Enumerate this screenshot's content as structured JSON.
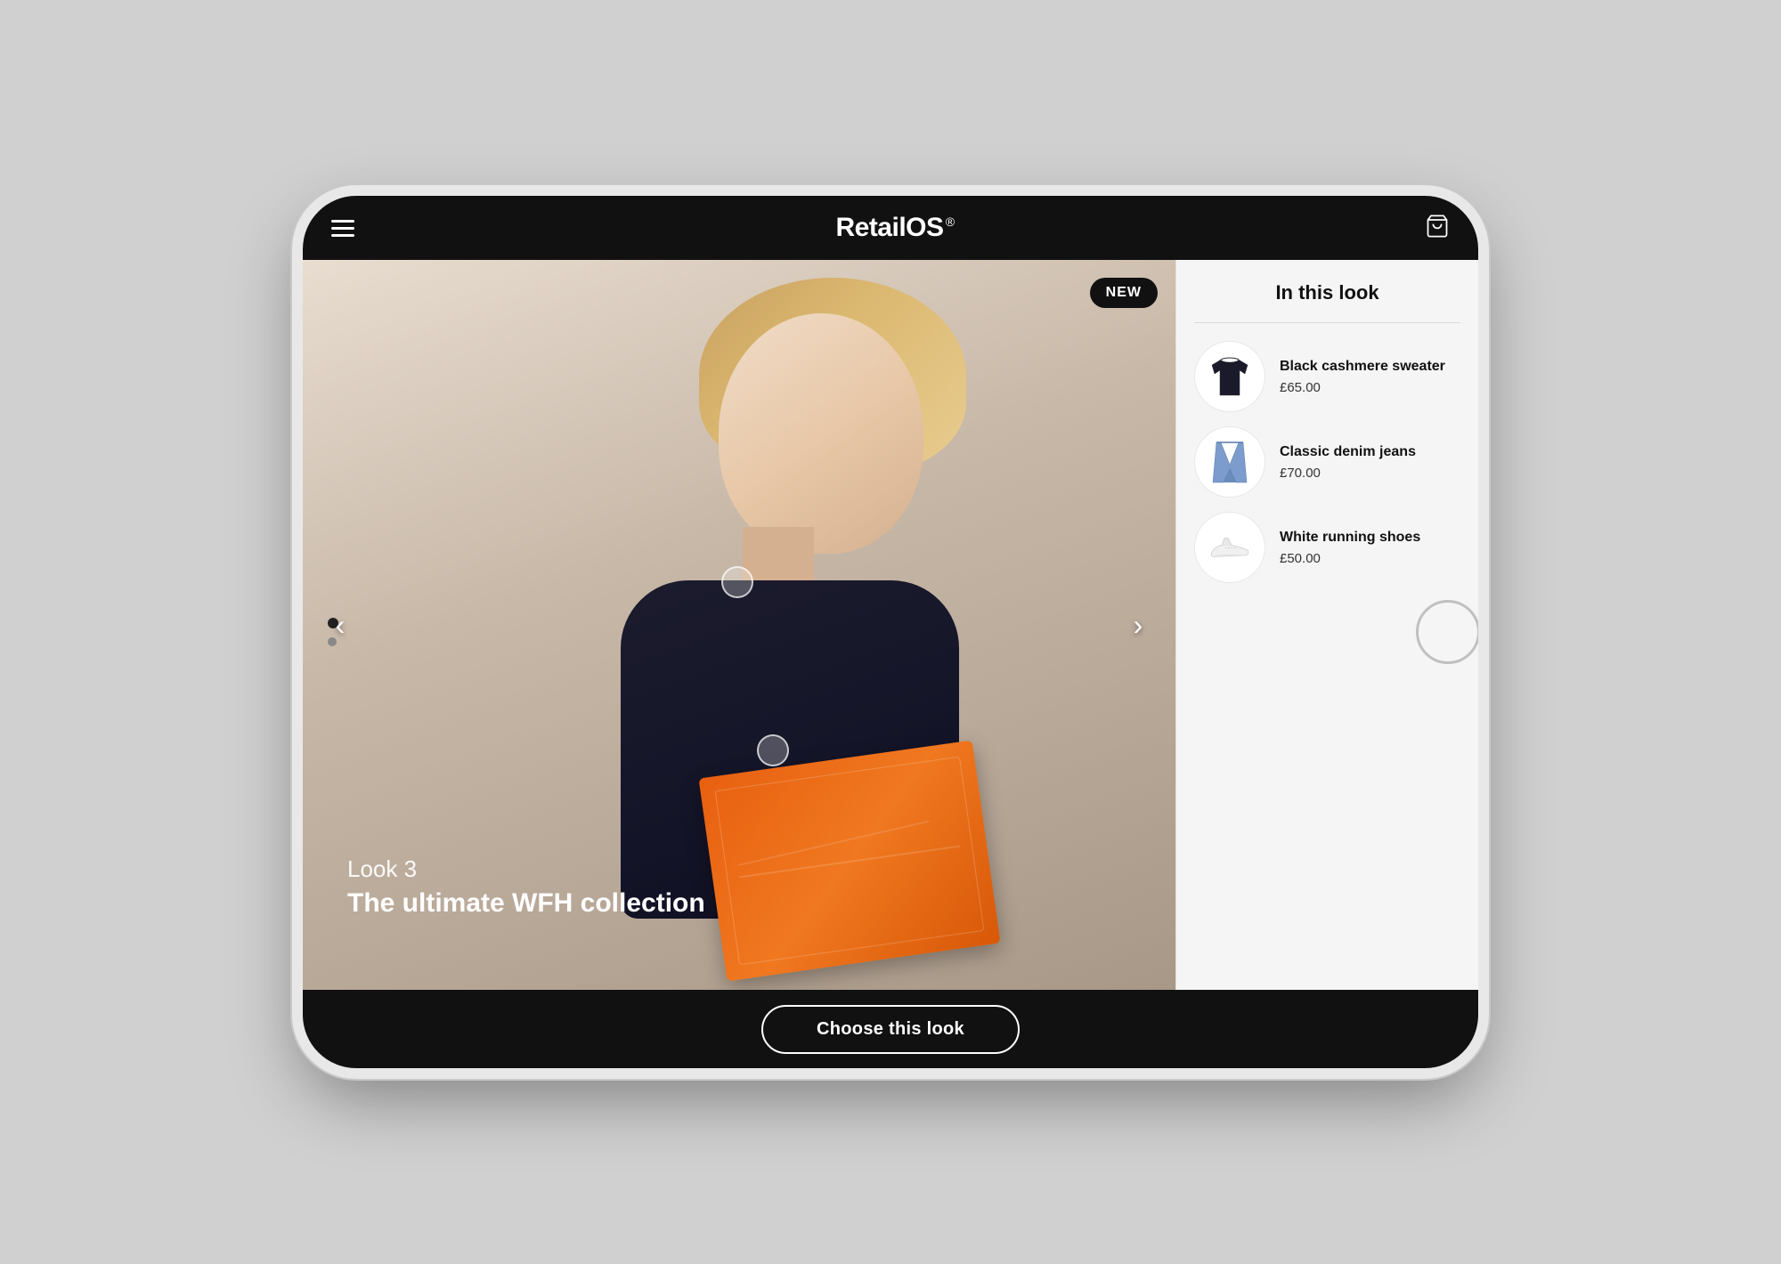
{
  "app": {
    "name": "RetailOS",
    "name_sup": "®"
  },
  "header": {
    "menu_label": "Menu",
    "cart_label": "Cart"
  },
  "new_badge": "NEW",
  "look": {
    "number": "Look 3",
    "title": "The ultimate WFH collection"
  },
  "panel": {
    "title": "In this look"
  },
  "products": [
    {
      "name": "Black cashmere sweater",
      "price": "£65.00",
      "thumb_type": "sweater"
    },
    {
      "name": "Classic denim jeans",
      "price": "£70.00",
      "thumb_type": "jeans"
    },
    {
      "name": "White running shoes",
      "price": "£50.00",
      "thumb_type": "shoes"
    }
  ],
  "navigation": {
    "dots": [
      {
        "active": true
      },
      {
        "active": false
      }
    ],
    "prev_arrow": "‹",
    "next_arrow": "›"
  },
  "cta": {
    "button_label": "Choose this look"
  }
}
